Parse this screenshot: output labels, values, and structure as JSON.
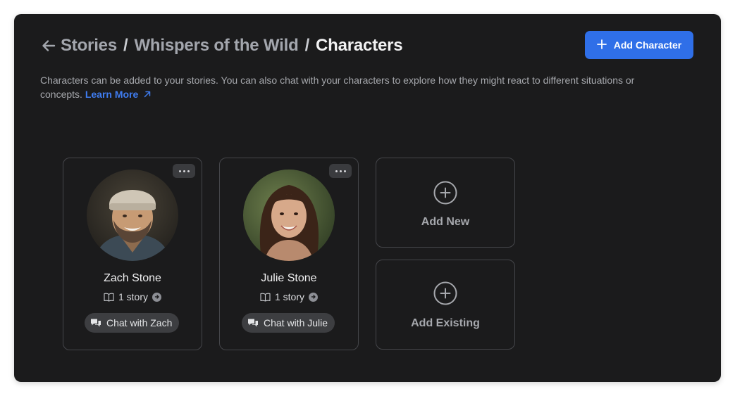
{
  "breadcrumb": {
    "items": [
      "Stories",
      "Whispers of the Wild"
    ],
    "current": "Characters",
    "separator": "/"
  },
  "header": {
    "add_button_label": "Add Character"
  },
  "description": {
    "text": "Characters can be added to your stories. You can also chat with your characters to explore how they might react to different situations or concepts.",
    "link_label": "Learn More"
  },
  "characters": [
    {
      "name": "Zach Stone",
      "stories": "1 story",
      "chat_label": "Chat with Zach"
    },
    {
      "name": "Julie Stone",
      "stories": "1 story",
      "chat_label": "Chat with Julie"
    }
  ],
  "actions": {
    "add_new_label": "Add New",
    "add_existing_label": "Add Existing"
  },
  "colors": {
    "panel_bg": "#1b1b1c",
    "accent": "#2f6fe8",
    "link": "#3f7cf0",
    "card_border": "#45464a"
  },
  "icons": [
    "back-arrow-icon",
    "plus-icon",
    "external-link-icon",
    "more-icon",
    "book-icon",
    "chevron-right-icon",
    "chat-bubbles-icon",
    "add-circle-icon"
  ]
}
